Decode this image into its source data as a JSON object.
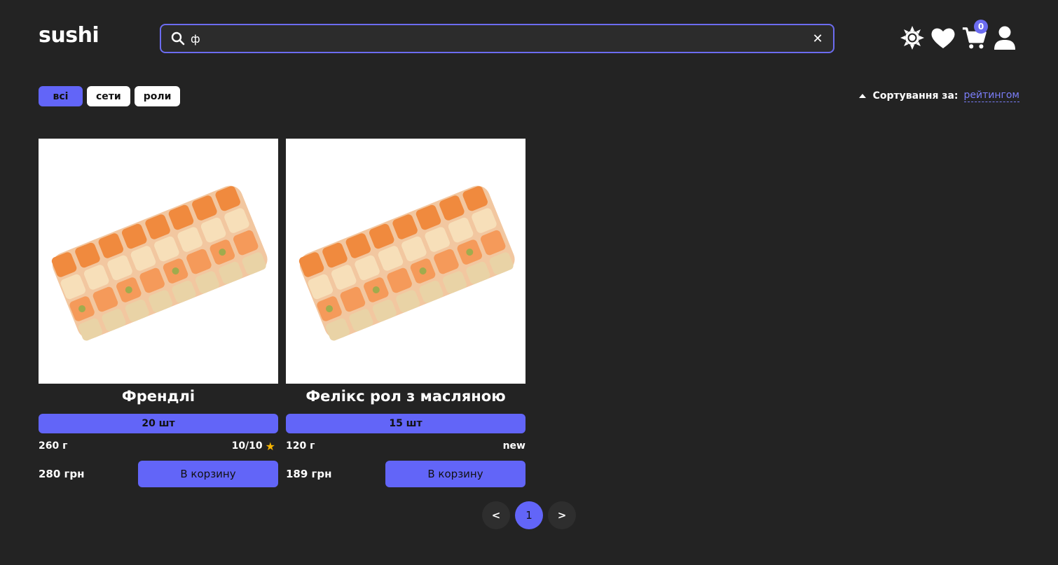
{
  "header": {
    "logo": "sushi",
    "search_value": "ф",
    "clear_symbol": "✕",
    "cart_count": "0"
  },
  "filters": {
    "items": [
      {
        "label": "всі",
        "active": true
      },
      {
        "label": "сети",
        "active": false
      },
      {
        "label": "роли",
        "active": false
      }
    ]
  },
  "sort": {
    "label": "Сортування за:",
    "value": "рейтингом"
  },
  "products": [
    {
      "name": "Френдлі",
      "quantity": "20 шт",
      "weight": "260 г",
      "rating": "10/10",
      "rating_icon": "star-icon",
      "price": "280 грн",
      "button": "В корзину"
    },
    {
      "name": "Фелікс рол з масляною",
      "quantity": "15 шт",
      "weight": "120 г",
      "badge": "new",
      "price": "189 грн",
      "button": "В корзину"
    }
  ],
  "pagination": {
    "prev": "<",
    "current": "1",
    "next": ">"
  },
  "colors": {
    "background": "#232323",
    "accent": "#6265f8",
    "star": "#f7b500"
  },
  "icons": [
    "search-icon",
    "close-icon",
    "sun-icon",
    "heart-icon",
    "cart-icon",
    "user-icon"
  ]
}
